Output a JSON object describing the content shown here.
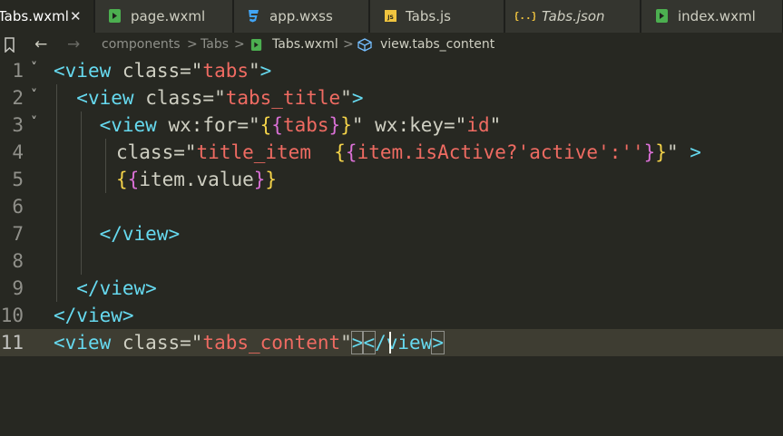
{
  "tabs": [
    {
      "label": "Tabs.wxml",
      "icon": "wxml-file-icon",
      "active": true,
      "close": "✕"
    },
    {
      "label": "page.wxml",
      "icon": "wxml-file-icon",
      "active": false
    },
    {
      "label": "app.wxss",
      "icon": "css-file-icon",
      "active": false
    },
    {
      "label": "Tabs.js",
      "icon": "js-file-icon",
      "active": false
    },
    {
      "label": "Tabs.json",
      "icon": "json-file-icon",
      "active": false
    },
    {
      "label": "index.wxml",
      "icon": "wxml-file-icon",
      "active": false
    }
  ],
  "breadcrumb": {
    "back": "←",
    "forward": "→",
    "items": [
      "components",
      "Tabs",
      "Tabs.wxml",
      "view.tabs_content"
    ],
    "separator": ">"
  },
  "editor": {
    "line_numbers": [
      "1",
      "2",
      "3",
      "4",
      "5",
      "6",
      "7",
      "8",
      "9",
      "10",
      "11"
    ],
    "fold_chevron": "˅",
    "current_line": "11"
  },
  "colors": {
    "background": "#272822",
    "tag": "#66d9ef",
    "string": "#ef6b62",
    "mustache_gold": "#f5d449",
    "mustache_violet": "#da70d6",
    "text": "#cfcfc2",
    "current_line": "#3e3d32"
  }
}
